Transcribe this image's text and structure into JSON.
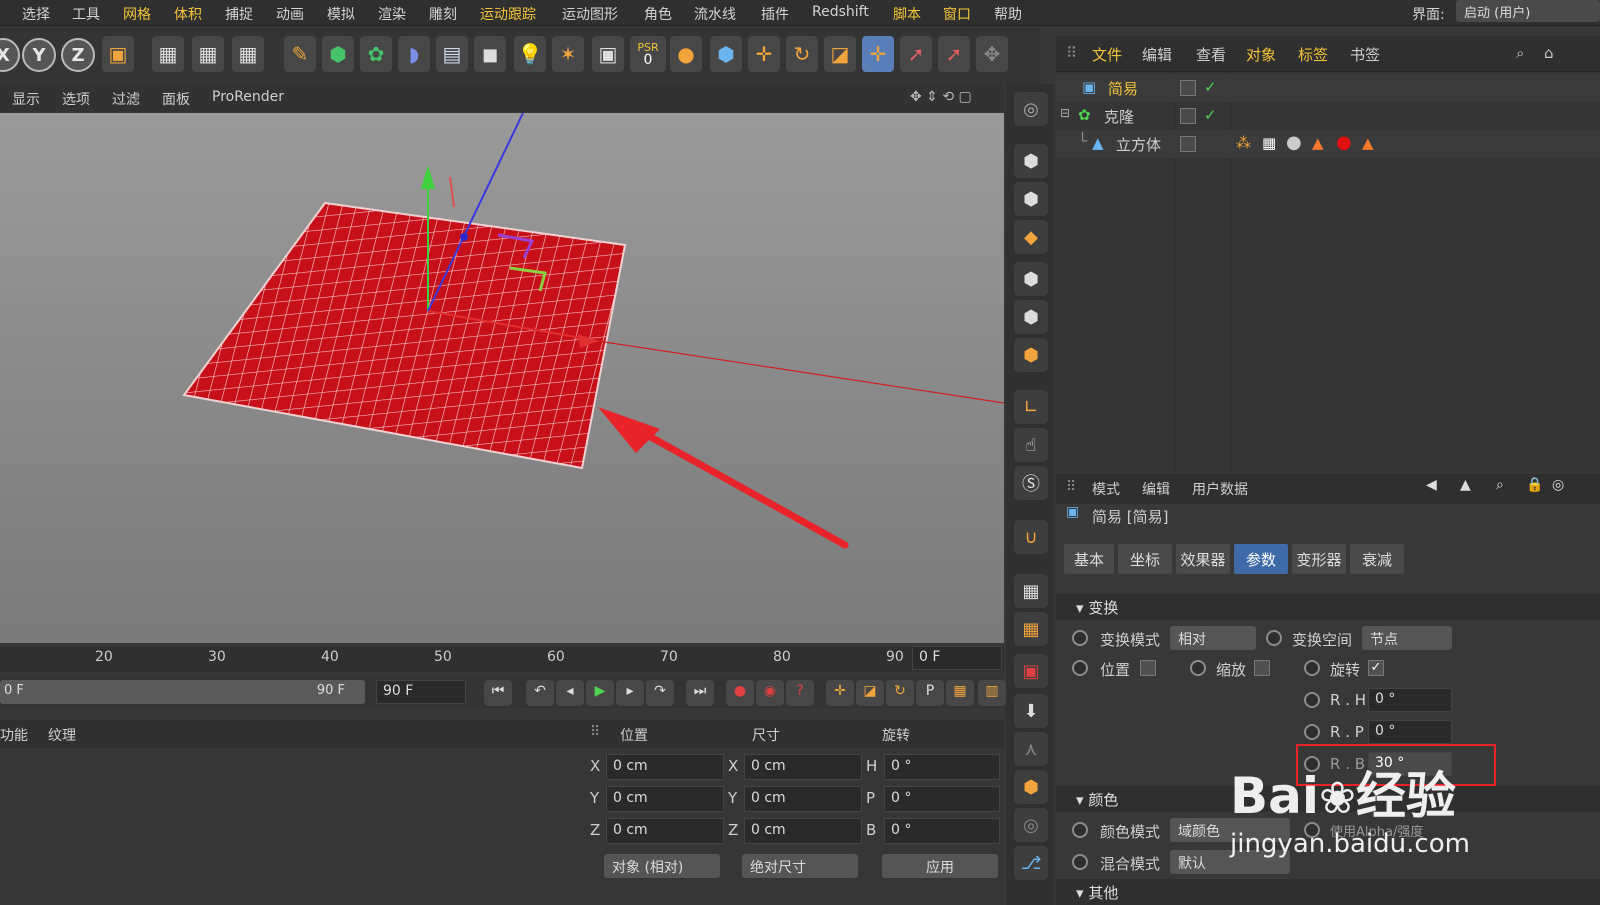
{
  "menu": [
    "选择",
    "工具",
    "网格",
    "体积",
    "捕捉",
    "动画",
    "模拟",
    "渲染",
    "雕刻",
    "运动跟踪",
    "运动图形",
    "角色",
    "流水线",
    "插件",
    "Redshift",
    "脚本",
    "窗口",
    "帮助"
  ],
  "layout_label": "界面:",
  "layout_value": "启动 (用户)",
  "axis_buttons": [
    "X",
    "Y",
    "Z"
  ],
  "psr_label": "PSR",
  "psr_value": "0",
  "viewport_menu": [
    "显示",
    "选项",
    "过滤",
    "面板",
    "ProRender"
  ],
  "obj_menu": [
    "文件",
    "编辑",
    "查看",
    "对象",
    "标签",
    "书签"
  ],
  "objects": [
    {
      "name": "简易",
      "check": "✓"
    },
    {
      "name": "克隆",
      "check": "✓"
    },
    {
      "name": "立方体",
      "check": ""
    }
  ],
  "attr_menu": [
    "模式",
    "编辑",
    "用户数据"
  ],
  "attr_title": "简易 [简易]",
  "attr_tabs": [
    "基本",
    "坐标",
    "效果器",
    "参数",
    "变形器",
    "衰减"
  ],
  "active_tab": "参数",
  "sections": {
    "transform": "变换",
    "color": "颜色",
    "other": "其他"
  },
  "transform": {
    "mode_label": "变换模式",
    "mode_value": "相对",
    "space_label": "变换空间",
    "space_value": "节点",
    "position": "位置",
    "scale": "缩放",
    "rotation": "旋转",
    "rotation_check": "✓",
    "rh_label": "R . H",
    "rh_value": "0 °",
    "rp_label": "R . P",
    "rp_value": "0 °",
    "rb_label": "R . B",
    "rb_value": "30 °"
  },
  "color": {
    "mode_label": "颜色模式",
    "mode_value": "域颜色",
    "blend_label": "混合模式",
    "blend_value": "默认",
    "alpha_label": "使用Alpha/强度"
  },
  "timeline_ticks": [
    "20",
    "30",
    "40",
    "50",
    "60",
    "70",
    "80",
    "90"
  ],
  "frame_current": "0 F",
  "range_start": "0 F",
  "range_end": "90 F",
  "frame_end": "90 F",
  "mat_tabs": [
    "功能",
    "纹理"
  ],
  "coord_headers": [
    "位置",
    "尺寸",
    "旋转"
  ],
  "coords": {
    "pos": [
      {
        "axis": "X",
        "val": "0 cm"
      },
      {
        "axis": "Y",
        "val": "0 cm"
      },
      {
        "axis": "Z",
        "val": "0 cm"
      }
    ],
    "size": [
      {
        "axis": "X",
        "val": "0 cm"
      },
      {
        "axis": "Y",
        "val": "0 cm"
      },
      {
        "axis": "Z",
        "val": "0 cm"
      }
    ],
    "rot": [
      {
        "axis": "H",
        "val": "0 °"
      },
      {
        "axis": "P",
        "val": "0 °"
      },
      {
        "axis": "B",
        "val": "0 °"
      }
    ]
  },
  "coord_mode": "对象 (相对)",
  "coord_size_mode": "绝对尺寸",
  "apply": "应用",
  "watermark": {
    "brand": "Bai",
    "brand2": "经验",
    "url": "jingyan.baidu.com"
  },
  "colors": {
    "accent": "#3f6aa8",
    "highlight": "#f3c53a",
    "plane": "#c8101a",
    "arrow": "#e8232a"
  }
}
